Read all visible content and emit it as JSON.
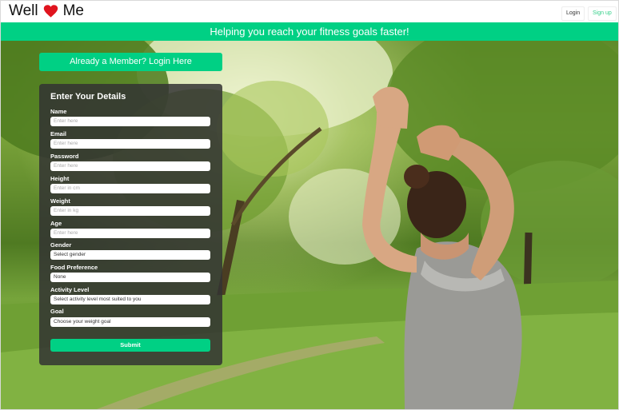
{
  "nav": {
    "brand_left": "Well",
    "brand_right": "Me",
    "login_label": "Login",
    "signup_label": "Sign up"
  },
  "banner": {
    "text": "Helping you reach your fitness goals faster!"
  },
  "member_button": "Already a Member? Login Here",
  "form": {
    "title": "Enter Your Details",
    "fields": [
      {
        "label": "Name",
        "placeholder": "Enter here"
      },
      {
        "label": "Email",
        "placeholder": "Enter here"
      },
      {
        "label": "Password",
        "placeholder": "Enter here"
      },
      {
        "label": "Height",
        "placeholder": "Enter in cm"
      },
      {
        "label": "Weight",
        "placeholder": "Enter in kg"
      },
      {
        "label": "Age",
        "placeholder": "Enter here"
      },
      {
        "label": "Gender",
        "value": "Select gender"
      },
      {
        "label": "Food Preference",
        "value": "None"
      },
      {
        "label": "Activity Level",
        "value": "Select activity level most suited to you"
      },
      {
        "label": "Goal",
        "value": "Choose your weight goal"
      }
    ],
    "submit_label": "Submit"
  },
  "colors": {
    "accent": "#00d084",
    "heart": "#e0141e"
  },
  "icons": {
    "brand_heart": "heart-icon"
  }
}
